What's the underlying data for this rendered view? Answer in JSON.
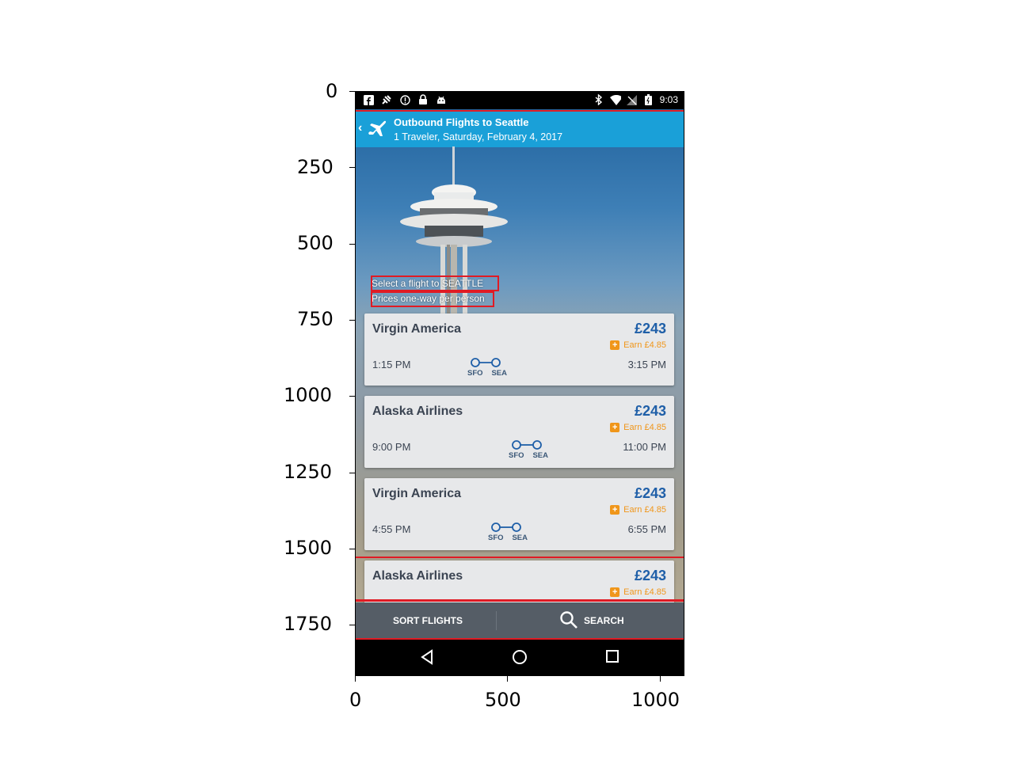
{
  "status_bar": {
    "time": "9:03"
  },
  "app_bar": {
    "title": "Outbound Flights to Seattle",
    "subtitle": "1 Traveler, Saturday, February 4, 2017"
  },
  "hero": {
    "line1": "Select a flight to SEATTLE",
    "line2": "Prices one-way per person"
  },
  "flights": [
    {
      "airline": "Virgin America",
      "price": "£243",
      "earn": "Earn £4.85",
      "depart": "1:15 PM",
      "arrive": "3:15 PM",
      "from": "SFO",
      "to": "SEA"
    },
    {
      "airline": "Alaska Airlines",
      "price": "£243",
      "earn": "Earn £4.85",
      "depart": "9:00 PM",
      "arrive": "11:00 PM",
      "from": "SFO",
      "to": "SEA"
    },
    {
      "airline": "Virgin America",
      "price": "£243",
      "earn": "Earn £4.85",
      "depart": "4:55 PM",
      "arrive": "6:55 PM",
      "from": "SFO",
      "to": "SEA"
    },
    {
      "airline": "Alaska Airlines",
      "price": "£243",
      "earn": "Earn £4.85"
    }
  ],
  "bottom_bar": {
    "sort_label": "SORT FLIGHTS",
    "search_label": "SEARCH"
  },
  "axes": {
    "x_ticks": [
      "0",
      "500",
      "1000"
    ],
    "y_ticks": [
      "0",
      "250",
      "500",
      "750",
      "1000",
      "1250",
      "1500",
      "1750"
    ]
  },
  "colors": {
    "app_bar": "#1aa0d8",
    "price": "#1f5fa8",
    "earn": "#f0961a",
    "annotation": "#e01b24"
  }
}
